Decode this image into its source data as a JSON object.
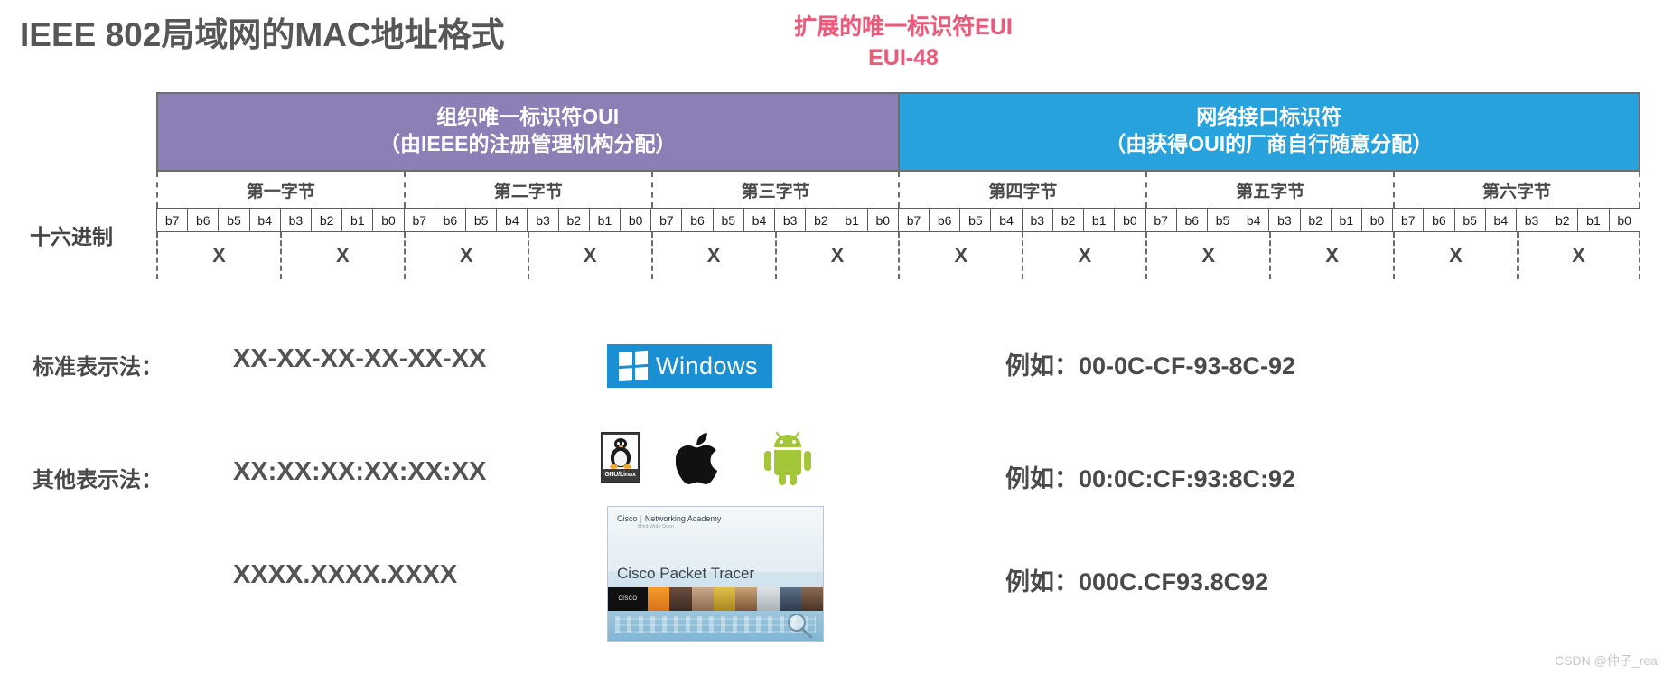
{
  "title": "IEEE 802局域网的MAC地址格式",
  "eui": {
    "line1": "扩展的唯一标识符EUI",
    "line2": "EUI-48",
    "color": "#ea5a7a"
  },
  "diagram": {
    "oui": {
      "line1": "组织唯一标识符OUI",
      "line2": "（由IEEE的注册管理机构分配）",
      "color": "#8b7fb5"
    },
    "nic": {
      "line1": "网络接口标识符",
      "line2": "（由获得OUI的厂商自行随意分配）",
      "color": "#28a2dd"
    },
    "bytes": [
      "第一字节",
      "第二字节",
      "第三字节",
      "第四字节",
      "第五字节",
      "第六字节"
    ],
    "bits_per_byte": [
      "b7",
      "b6",
      "b5",
      "b4",
      "b3",
      "b2",
      "b1",
      "b0"
    ],
    "bits": [
      "b7",
      "b6",
      "b5",
      "b4",
      "b3",
      "b2",
      "b1",
      "b0",
      "b7",
      "b6",
      "b5",
      "b4",
      "b3",
      "b2",
      "b1",
      "b0",
      "b7",
      "b6",
      "b5",
      "b4",
      "b3",
      "b2",
      "b1",
      "b0",
      "b7",
      "b6",
      "b5",
      "b4",
      "b3",
      "b2",
      "b1",
      "b0",
      "b7",
      "b6",
      "b5",
      "b4",
      "b3",
      "b2",
      "b1",
      "b0",
      "b7",
      "b6",
      "b5",
      "b4",
      "b3",
      "b2",
      "b1",
      "b0"
    ],
    "hex_label": "十六进制",
    "hex_digits": [
      "X",
      "X",
      "X",
      "X",
      "X",
      "X",
      "X",
      "X",
      "X",
      "X",
      "X",
      "X"
    ]
  },
  "notations": {
    "standard": {
      "label": "标准表示法：",
      "value": "XX-XX-XX-XX-XX-XX",
      "example": "例如：00-0C-CF-93-8C-92"
    },
    "other": {
      "label": "其他表示法：",
      "value": "XX:XX:XX:XX:XX:XX",
      "example": "例如：00:0C:CF:93:8C:92"
    },
    "dotted": {
      "value": "XXXX.XXXX.XXXX",
      "example": "例如：000C.CF93.8C92"
    }
  },
  "logos": {
    "windows": {
      "text": "Windows"
    },
    "linux": {
      "text": "GNU/Linux"
    },
    "apple": {
      "name": "apple-logo"
    },
    "android": {
      "name": "android-logo"
    },
    "packet_tracer": {
      "brand_left": "Cisco",
      "brand_right": "Networking Academy",
      "brand_sub": "Mind Wide Open",
      "title": "Cisco Packet Tracer",
      "logo_text": "CISCO"
    }
  },
  "watermark": "CSDN @仲子_real"
}
